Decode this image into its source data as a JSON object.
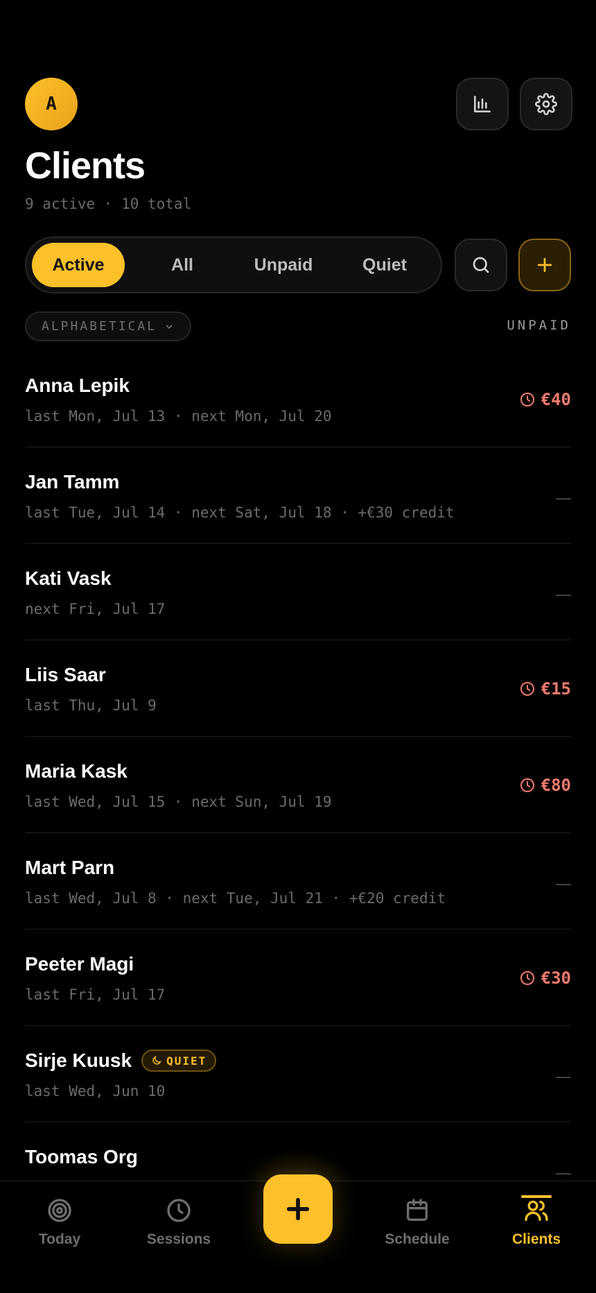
{
  "header": {
    "avatar_initial": "A",
    "title": "Clients",
    "subtitle": "9 active · 10 total"
  },
  "filters": {
    "tabs": [
      {
        "label": "Active",
        "selected": true
      },
      {
        "label": "All",
        "selected": false
      },
      {
        "label": "Unpaid",
        "selected": false
      },
      {
        "label": "Quiet",
        "selected": false
      }
    ]
  },
  "sort": {
    "label": "ALPHABETICAL",
    "column_header": "UNPAID"
  },
  "clients": [
    {
      "name": "Anna Lepik",
      "meta": "last Mon, Jul 13 · next Mon, Jul 20",
      "unpaid": "€40"
    },
    {
      "name": "Jan Tamm",
      "meta": "last Tue, Jul 14 · next Sat, Jul 18 · +€30 credit",
      "unpaid": "—"
    },
    {
      "name": "Kati Vask",
      "meta": "next Fri, Jul 17",
      "unpaid": "—"
    },
    {
      "name": "Liis Saar",
      "meta": "last Thu, Jul 9",
      "unpaid": "€15"
    },
    {
      "name": "Maria Kask",
      "meta": "last Wed, Jul 15 · next Sun, Jul 19",
      "unpaid": "€80"
    },
    {
      "name": "Mart Parn",
      "meta": "last Wed, Jul 8 · next Tue, Jul 21 · +€20 credit",
      "unpaid": "—"
    },
    {
      "name": "Peeter Magi",
      "meta": "last Fri, Jul 17",
      "unpaid": "€30"
    },
    {
      "name": "Sirje Kuusk",
      "badge": "QUIET",
      "meta": "last Wed, Jun 10",
      "unpaid": "—"
    },
    {
      "name": "Toomas Org",
      "meta": "",
      "unpaid": "—"
    }
  ],
  "tabbar": {
    "items": [
      {
        "label": "Today",
        "icon": "target-icon"
      },
      {
        "label": "Sessions",
        "icon": "clock-icon"
      },
      {
        "label": "Schedule",
        "icon": "calendar-icon"
      },
      {
        "label": "Clients",
        "icon": "users-icon",
        "active": true
      }
    ]
  },
  "colors": {
    "accent": "#fcc02a",
    "unpaid": "#f07a6e",
    "background": "#000000"
  }
}
